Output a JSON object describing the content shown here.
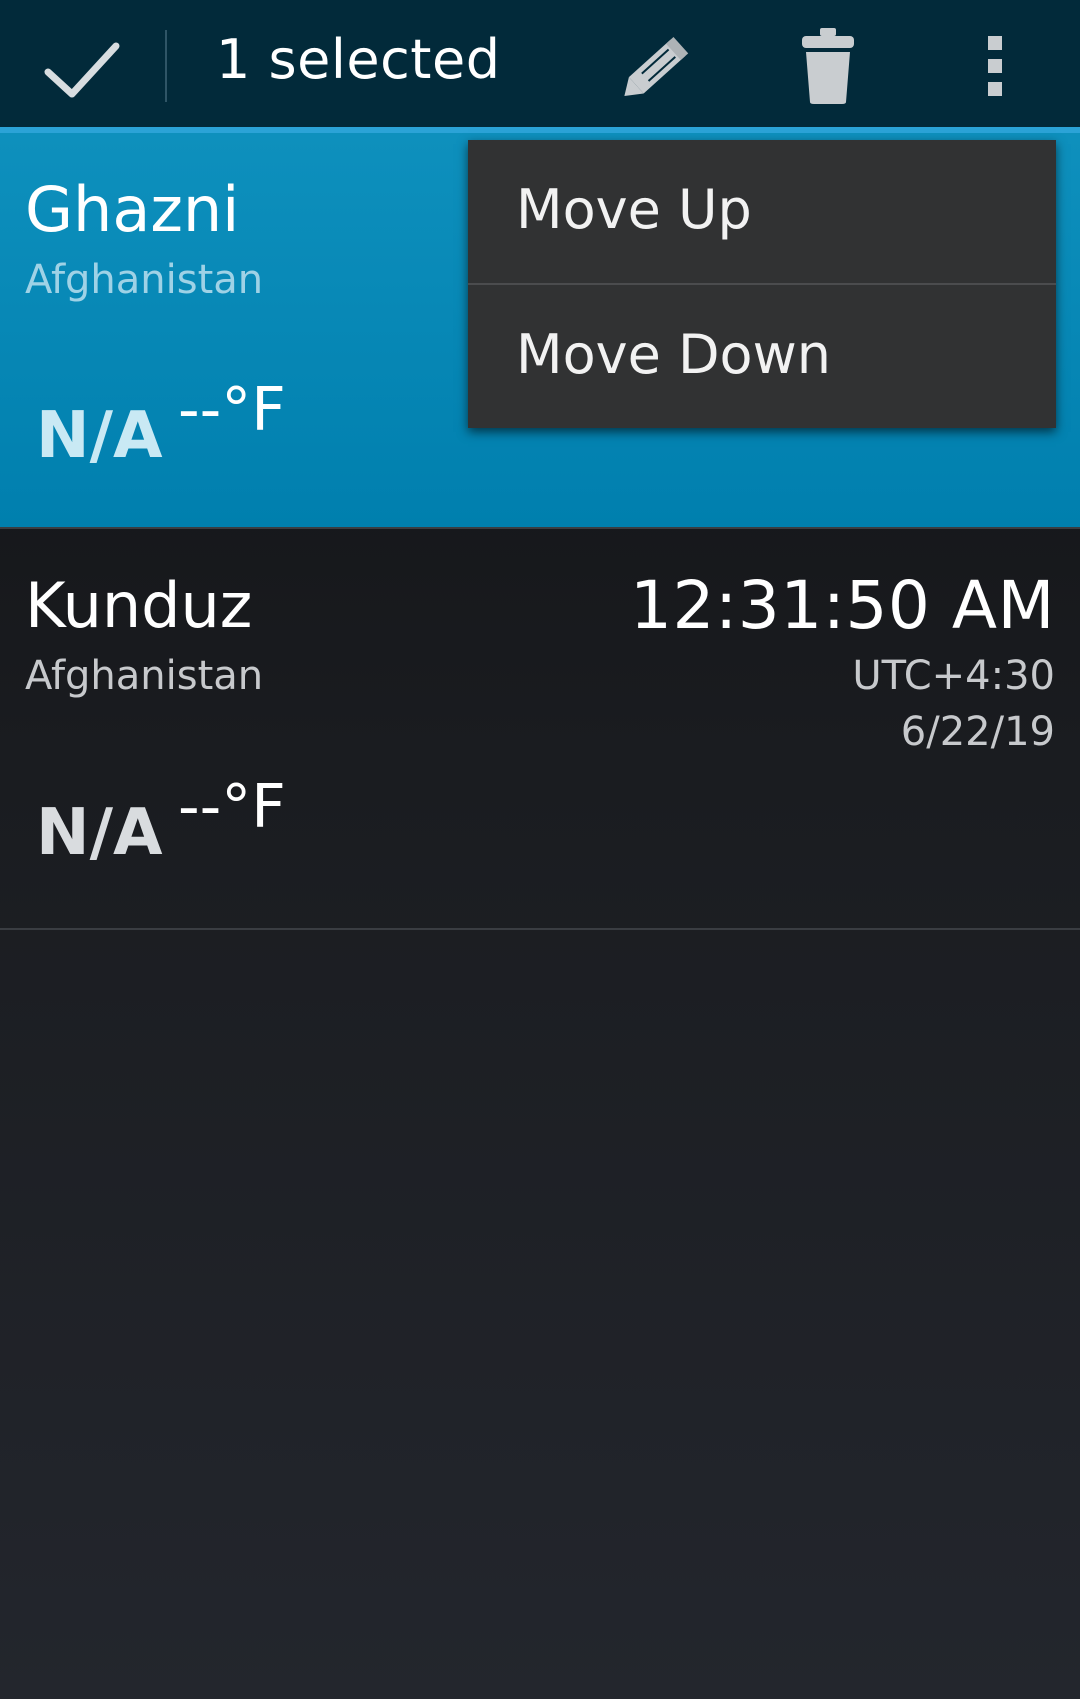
{
  "action_bar": {
    "title": "1 selected",
    "done_icon": "check-icon",
    "edit_icon": "pencil-icon",
    "delete_icon": "trash-icon",
    "overflow_icon": "more-vert-icon",
    "accent_color": "#2ba3d7"
  },
  "cities": [
    {
      "name": "Ghazni",
      "country": "Afghanistan",
      "condition": "N/A",
      "temp": "--°F",
      "selected": true
    },
    {
      "name": "Kunduz",
      "country": "Afghanistan",
      "condition": "N/A",
      "temp": "--°F",
      "time": "12:31:50 AM",
      "utc_offset": "UTC+4:30",
      "date": "6/22/19",
      "selected": false
    }
  ],
  "overflow_menu": {
    "items": [
      {
        "label": "Move Up"
      },
      {
        "label": "Move Down"
      }
    ]
  },
  "colors": {
    "selected_row": "#0189b8",
    "action_bar_bg": "#022a3a"
  }
}
